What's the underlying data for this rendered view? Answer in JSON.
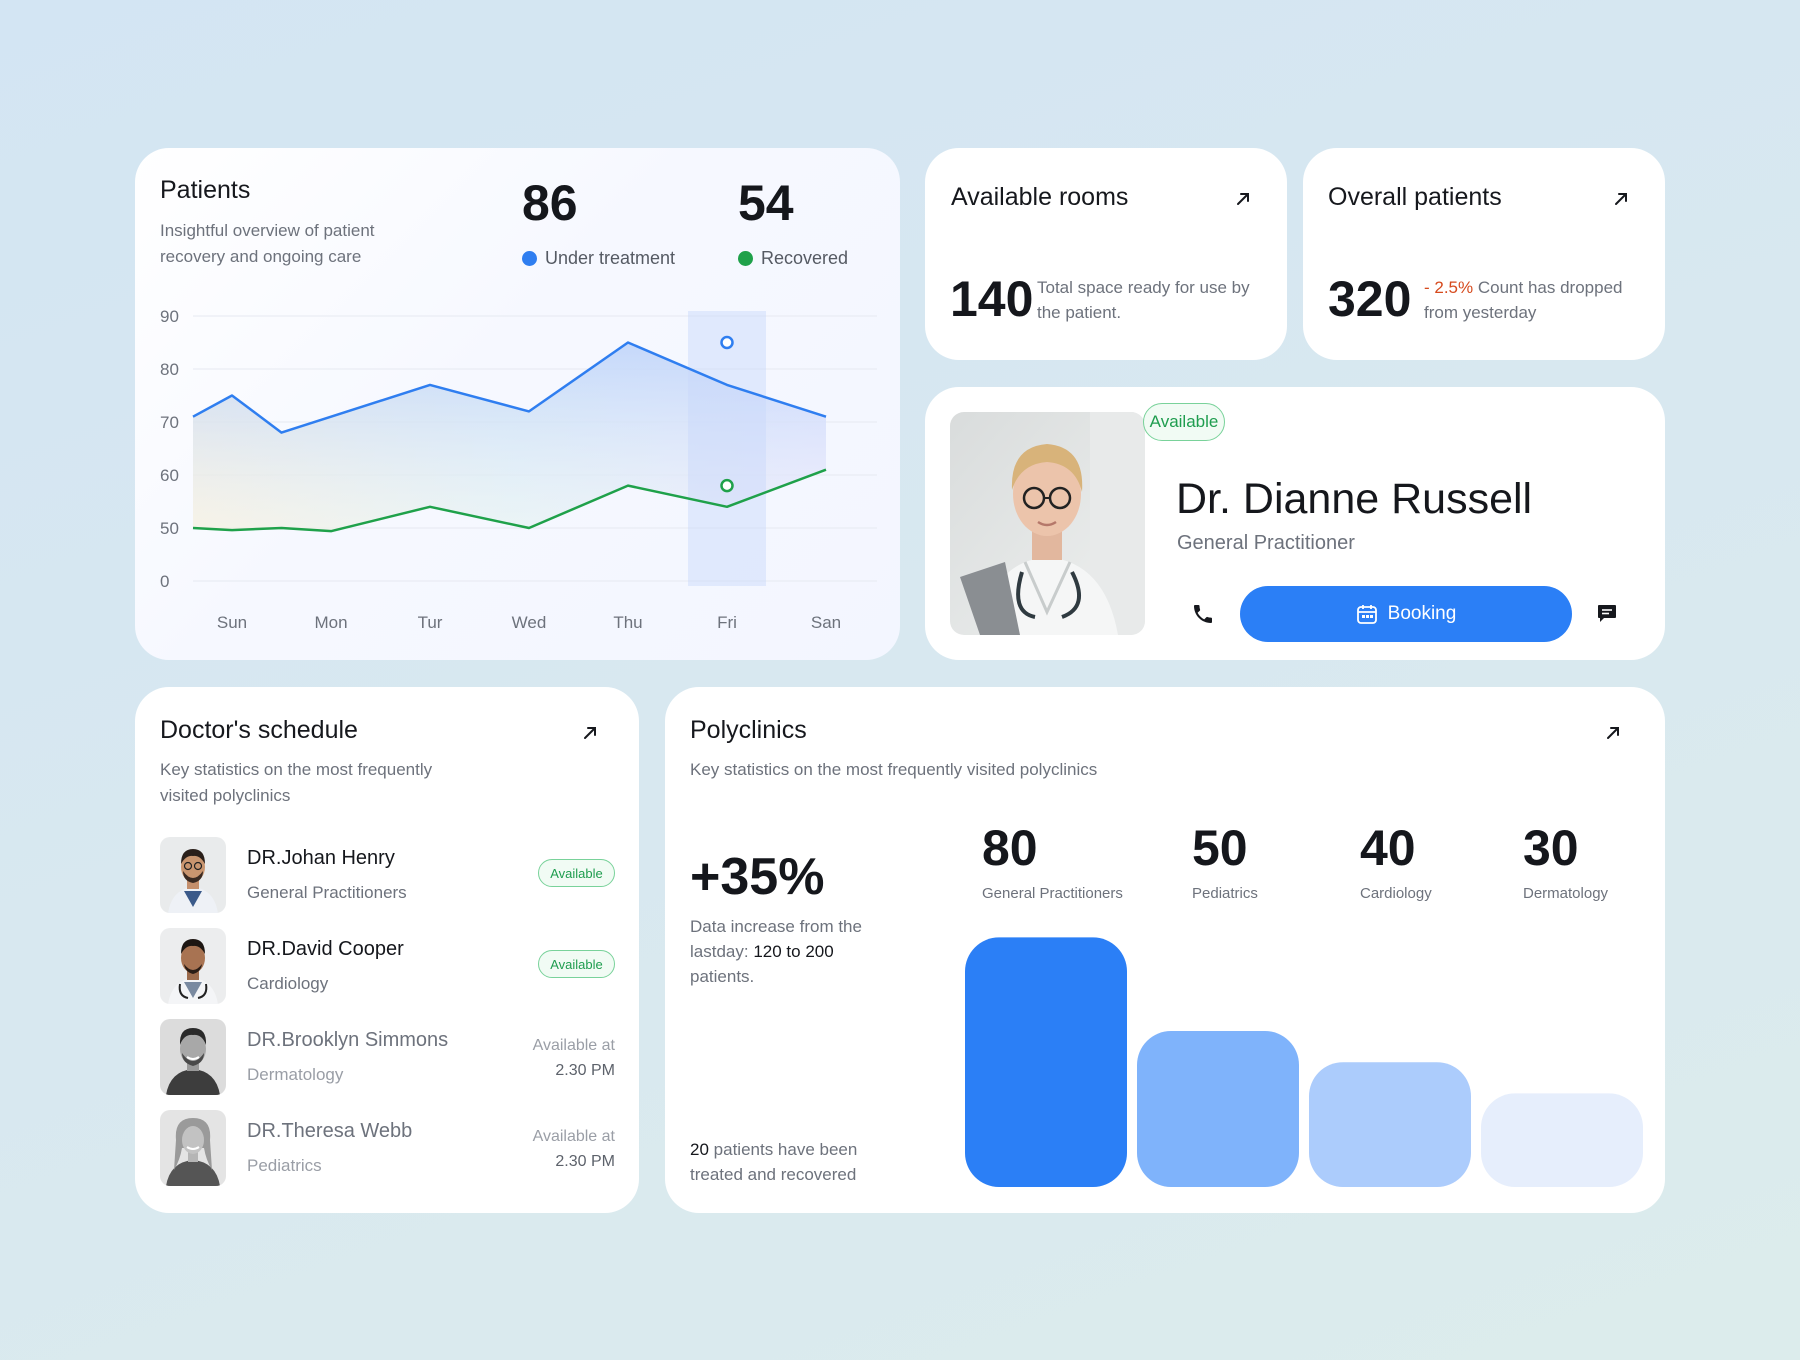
{
  "patients": {
    "title": "Patients",
    "subtitle_line1": "Insightful overview of patient",
    "subtitle_line2": "recovery and ongoing care",
    "under_treatment_count": "86",
    "under_treatment_label": "Under treatment",
    "recovered_count": "54",
    "recovered_label": "Recovered",
    "colors": {
      "under_treatment": "#2f7ef0",
      "recovered": "#1fa14a"
    }
  },
  "chart_data": {
    "type": "line",
    "categories": [
      "Sun",
      "Mon",
      "Tur",
      "Wed",
      "Thu",
      "Fri",
      "San"
    ],
    "y_tick_labels": [
      "0",
      "50",
      "60",
      "70",
      "80",
      "90"
    ],
    "series": [
      {
        "name": "Under treatment",
        "values": [
          71,
          75,
          68,
          71,
          77,
          72,
          85,
          77,
          71
        ]
      },
      {
        "name": "Recovered",
        "values": [
          50,
          48,
          50,
          47,
          54,
          50,
          58,
          54,
          61
        ]
      }
    ],
    "x_positions": [
      -0.5,
      0,
      0.5,
      1,
      2,
      3,
      4,
      5,
      6
    ],
    "highlight_category": "Fri",
    "highlight_values": {
      "Under treatment": 85,
      "Recovered": 58
    }
  },
  "rooms": {
    "title": "Available rooms",
    "value": "140",
    "desc": "Total space ready for use by the patient."
  },
  "overall": {
    "title": "Overall patients",
    "value": "320",
    "change": "- 2.5%",
    "desc": "Count has dropped from yesterday"
  },
  "doctor": {
    "status": "Available",
    "name": "Dr. Dianne Russell",
    "role": "General Practitioner",
    "booking_label": "Booking"
  },
  "schedule": {
    "title": "Doctor's schedule",
    "subtitle_line1": "Key statistics on the most frequently",
    "subtitle_line2": "visited polyclinics",
    "doctors": [
      {
        "name": "DR.Johan Henry",
        "specialty": "General Practitioners",
        "status": "Available"
      },
      {
        "name": "DR.David Cooper",
        "specialty": "Cardiology",
        "status": "Available"
      },
      {
        "name": "DR.Brooklyn Simmons",
        "specialty": "Dermatology",
        "avail_label": "Available at",
        "avail_time": "2.30 PM"
      },
      {
        "name": "DR.Theresa Webb",
        "specialty": "Pediatrics",
        "avail_label": "Available at",
        "avail_time": "2.30 PM"
      }
    ]
  },
  "polyclinics": {
    "title": "Polyclinics",
    "subtitle": "Key statistics on the most frequently visited polyclinics",
    "increase": "+35%",
    "desc_pre": "Data increase from the lastday:",
    "desc_bold": "120 to 200",
    "desc_post": "patients.",
    "foot_bold": "20",
    "foot_text": "patients have been treated and recovered",
    "clinics": [
      {
        "value": 80,
        "label": "General Practitioners",
        "color": "#2b7ff6"
      },
      {
        "value": 50,
        "label": "Pediatrics",
        "color": "#7fb3fb"
      },
      {
        "value": 40,
        "label": "Cardiology",
        "color": "#acccfc"
      },
      {
        "value": 30,
        "label": "Dermatology",
        "color": "#e6eefc"
      }
    ]
  }
}
